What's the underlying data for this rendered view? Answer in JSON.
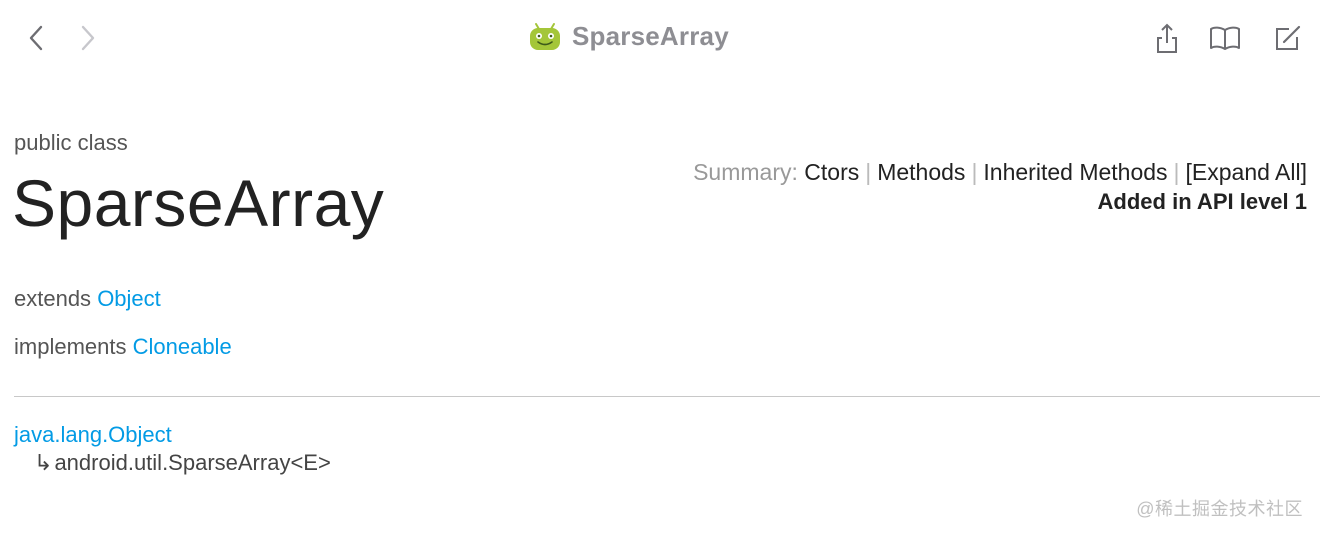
{
  "toolbar": {
    "title": "SparseArray",
    "back_icon": "chevron-left-icon",
    "forward_icon": "chevron-right-icon",
    "share_icon": "share-icon",
    "book_icon": "book-icon",
    "edit_icon": "edit-icon",
    "logo_icon": "android-logo-icon"
  },
  "header": {
    "modifier": "public class",
    "class_name": "SparseArray"
  },
  "summary": {
    "label": "Summary:",
    "links": [
      "Ctors",
      "Methods",
      "Inherited Methods",
      "[Expand All]"
    ],
    "separator": "|",
    "api_level": "Added in API level 1"
  },
  "inheritance": {
    "extends_label": "extends",
    "extends_value": "Object",
    "implements_label": "implements",
    "implements_value": "Cloneable"
  },
  "hierarchy": {
    "root": "java.lang.Object",
    "arrow": "↳",
    "child": "android.util.SparseArray<E>"
  },
  "watermark": "@稀土掘金技术社区",
  "colors": {
    "link": "#039be5",
    "title_gray": "#8e8e93",
    "android_green": "#a4c639"
  }
}
